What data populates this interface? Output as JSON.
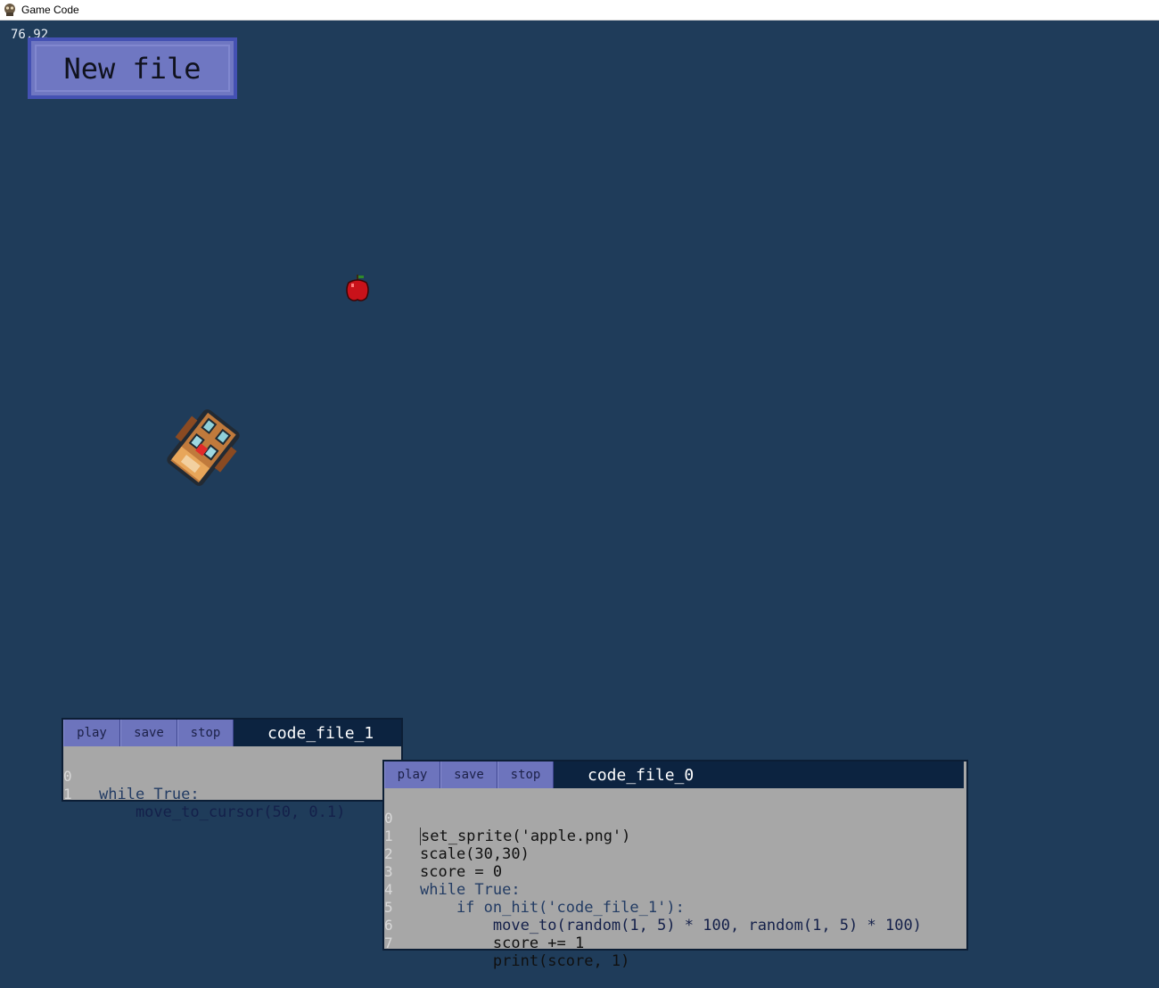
{
  "window": {
    "title": "Game Code",
    "icon": "game-controller-icon"
  },
  "hud": {
    "fps": "76.92"
  },
  "toolbar": {
    "new_file_label": "New file"
  },
  "sprites": [
    {
      "name": "apple",
      "icon": "apple-sprite"
    },
    {
      "name": "spaceship",
      "icon": "spaceship-sprite"
    }
  ],
  "editors": [
    {
      "id": "code_file_1",
      "buttons": {
        "play": "play",
        "save": "save",
        "stop": "stop"
      },
      "file_name": "code_file_1",
      "lines": [
        {
          "num": "0",
          "text": "while True:"
        },
        {
          "num": "1",
          "text": "    move_to_cursor(50, 0.1)"
        }
      ]
    },
    {
      "id": "code_file_0",
      "buttons": {
        "play": "play",
        "save": "save",
        "stop": "stop"
      },
      "file_name": "code_file_0",
      "lines": [
        {
          "num": "0",
          "text": "set_sprite('apple.png')"
        },
        {
          "num": "1",
          "text": "scale(30,30)"
        },
        {
          "num": "2",
          "text": "score = 0"
        },
        {
          "num": "3",
          "text": "while True:"
        },
        {
          "num": "4",
          "text": "    if on_hit('code_file_1'):"
        },
        {
          "num": "5",
          "text": "        move_to(random(1, 5) * 100, random(1, 5) * 100)"
        },
        {
          "num": "6",
          "text": "        score += 1"
        },
        {
          "num": "7",
          "text": "        print(score, 1)"
        }
      ]
    }
  ],
  "colors": {
    "background": "#1f3c5a",
    "button_fill": "#6f77c2",
    "button_border": "#4451b3",
    "editor_body": "#a7a7a7",
    "editor_tabbar": "#0c2340",
    "number_literal": "#f1f4a8"
  }
}
